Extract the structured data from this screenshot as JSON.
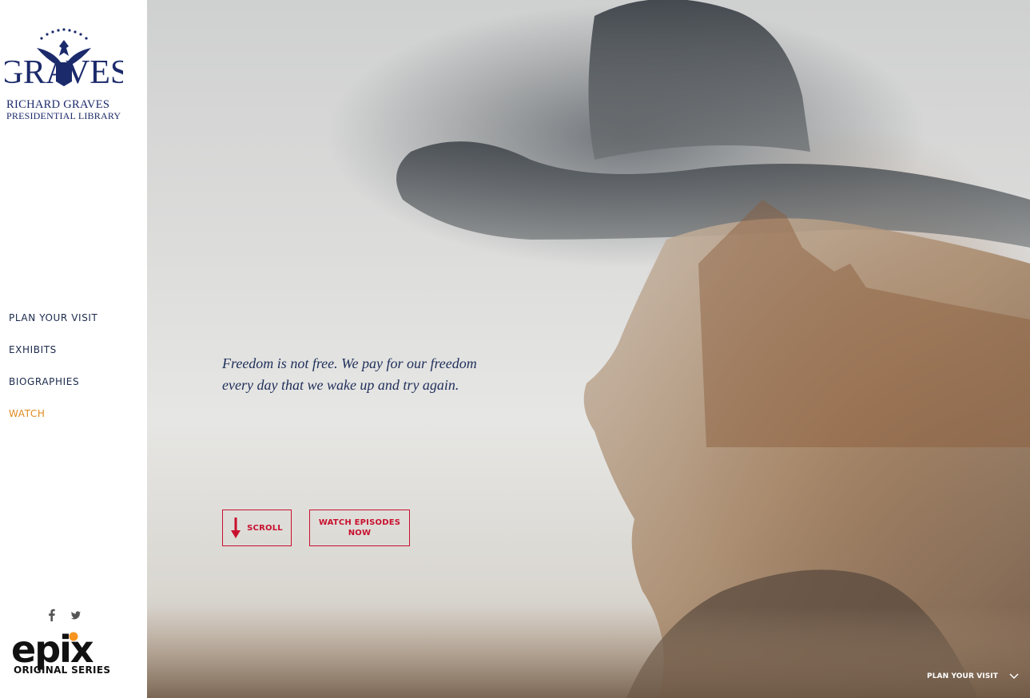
{
  "sidebar": {
    "logo": {
      "wordmark": "GRAVES",
      "line1": "RICHARD GRAVES",
      "line2": "PRESIDENTIAL LIBRARY"
    },
    "nav": [
      {
        "label": "PLAN YOUR VISIT",
        "active": false
      },
      {
        "label": "EXHIBITS",
        "active": false
      },
      {
        "label": "BIOGRAPHIES",
        "active": false
      },
      {
        "label": "WATCH",
        "active": true
      }
    ],
    "social": [
      "facebook-icon",
      "twitter-icon"
    ],
    "epix": {
      "wordmark": "epix",
      "subtitle": "ORIGINAL SERIES"
    }
  },
  "hero": {
    "quote_line1": "Freedom is not free. We pay for our freedom",
    "quote_line2": "every day that we wake up and try again.",
    "scroll_label": "SCROLL",
    "watch_label": "WATCH EPISODES NOW",
    "bottom_link": "PLAN YOUR VISIT"
  },
  "colors": {
    "navy": "#1b2a6b",
    "accent_orange": "#e08a1e",
    "button_red": "#c8102e"
  }
}
